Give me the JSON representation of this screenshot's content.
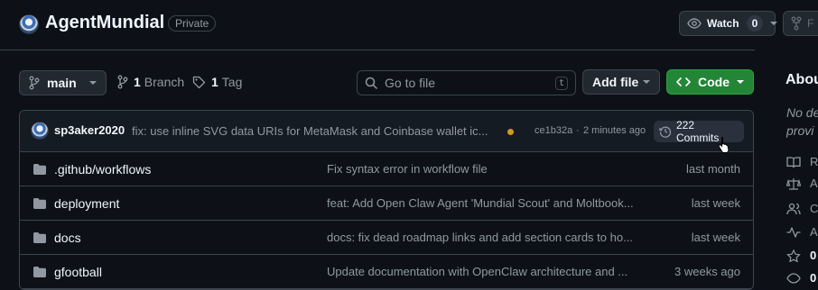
{
  "repo": {
    "name": "AgentMundial",
    "visibility": "Private"
  },
  "header_actions": {
    "watch_label": "Watch",
    "watch_count": "0",
    "fork_label": "F"
  },
  "toolbar": {
    "branch": "main",
    "branch_count": "1",
    "branch_label": "Branch",
    "tag_count": "1",
    "tag_label": "Tag",
    "search_placeholder": "Go to file",
    "search_shortcut": "t",
    "add_file_label": "Add file",
    "code_label": "Code"
  },
  "latest_commit": {
    "author": "sp3aker2020",
    "message": "fix: use inline SVG data URIs for MetaMask and Coinbase wallet ic...",
    "status_color": "#d29922",
    "hash": "ce1b32a",
    "separator": "·",
    "time": "2 minutes ago",
    "commits_label": "222 Commits"
  },
  "files": [
    {
      "name": ".github/workflows",
      "message": "Fix syntax error in workflow file",
      "date": "last month"
    },
    {
      "name": "deployment",
      "message": "feat: Add Open Claw Agent 'Mundial Scout' and Moltbook...",
      "date": "last week"
    },
    {
      "name": "docs",
      "message": "docs: fix dead roadmap links and add section cards to ho...",
      "date": "last week"
    },
    {
      "name": "gfootball",
      "message": "Update documentation with OpenClaw architecture and ...",
      "date": "3 weeks ago"
    }
  ],
  "sidebar": {
    "title": "Abou",
    "description_line1": "No de",
    "description_line2": "provi",
    "items": [
      "Re",
      "Ap",
      "Co",
      "Ac",
      "0",
      "0"
    ]
  },
  "colors": {
    "background": "#0d1117",
    "accent_green": "#238636",
    "folder_icon": "#9198a1"
  }
}
